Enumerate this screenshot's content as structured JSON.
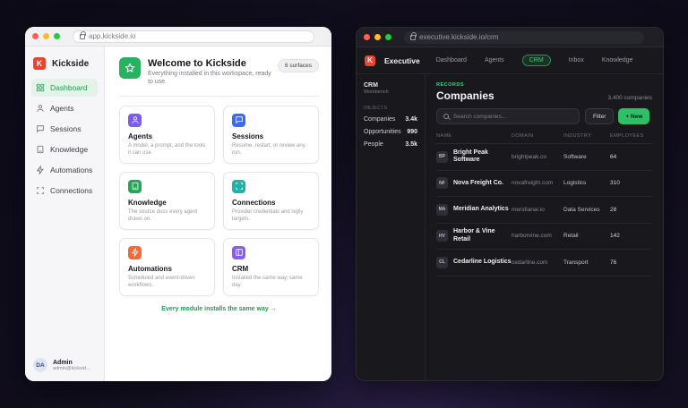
{
  "left_window": {
    "url": "app.kickside.io",
    "brand": "Kickside",
    "nav": [
      {
        "label": "Dashboard",
        "icon": "grid-icon",
        "active": true
      },
      {
        "label": "Agents",
        "icon": "user-icon",
        "active": false
      },
      {
        "label": "Sessions",
        "icon": "chat-icon",
        "active": false
      },
      {
        "label": "Knowledge",
        "icon": "book-icon",
        "active": false
      },
      {
        "label": "Automations",
        "icon": "bolt-icon",
        "active": false
      },
      {
        "label": "Connections",
        "icon": "frame-icon",
        "active": false
      }
    ],
    "admin": {
      "initials": "DA",
      "name": "Admin",
      "email": "admin@kicksid..."
    },
    "welcome": {
      "title": "Welcome to Kickside",
      "subtitle": "Everything installed in this workspace, ready to use.",
      "badge": "6 surfaces"
    },
    "cards": [
      {
        "title": "Agents",
        "desc": "A model, a prompt, and the tools it can use.",
        "color": "#7c5cf0",
        "icon": "user-icon"
      },
      {
        "title": "Sessions",
        "desc": "Resume, restart, or review any run.",
        "color": "#3b6cf0",
        "icon": "chat-icon"
      },
      {
        "title": "Knowledge",
        "desc": "The source docs every agent draws on.",
        "color": "#27a65a",
        "icon": "book-icon"
      },
      {
        "title": "Connections",
        "desc": "Provider credentials and reply targets.",
        "color": "#1fb3a8",
        "icon": "frame-icon"
      },
      {
        "title": "Automations",
        "desc": "Scheduled and event-driven workflows.",
        "color": "#f06a3a",
        "icon": "bolt-icon"
      },
      {
        "title": "CRM",
        "desc": "Installed the same way, same day.",
        "color": "#8a5cf0",
        "icon": "layout-icon"
      }
    ],
    "footer_link": "Every module installs the same way →"
  },
  "right_window": {
    "url": "executive.kickside.io/crm",
    "brand": "Executive",
    "tabs": [
      {
        "label": "Dashboard",
        "active": false
      },
      {
        "label": "Agents",
        "active": false
      },
      {
        "label": "CRM",
        "active": true
      },
      {
        "label": "Inbox",
        "active": false
      },
      {
        "label": "Knowledge",
        "active": false
      }
    ],
    "sidebar": {
      "title": "CRM",
      "subtitle": "Workbench",
      "section": "OBJECTS",
      "objects": [
        {
          "label": "Companies",
          "count": "3.4k"
        },
        {
          "label": "Opportunities",
          "count": "990"
        },
        {
          "label": "People",
          "count": "3.5k"
        }
      ]
    },
    "records_label": "RECORDS",
    "title": "Companies",
    "count": "3,400 companies",
    "search_placeholder": "Search companies...",
    "filter_label": "Filter",
    "new_label": "+ New",
    "columns": [
      "NAME",
      "DOMAIN",
      "INDUSTRY",
      "EMPLOYEES"
    ],
    "rows": [
      {
        "initials": "BP",
        "name": "Bright Peak Software",
        "domain": "brightpeak.co",
        "industry": "Software",
        "employees": "64"
      },
      {
        "initials": "NF",
        "name": "Nova Freight Co.",
        "domain": "novafreight.com",
        "industry": "Logistics",
        "employees": "310"
      },
      {
        "initials": "MA",
        "name": "Meridian Analytics",
        "domain": "meridianai.io",
        "industry": "Data Services",
        "employees": "28"
      },
      {
        "initials": "HV",
        "name": "Harbor & Vine Retail",
        "domain": "harborvine.com",
        "industry": "Retail",
        "employees": "142"
      },
      {
        "initials": "CL",
        "name": "Cedarline Logistics",
        "domain": "cedarline.com",
        "industry": "Transport",
        "employees": "76"
      }
    ]
  }
}
